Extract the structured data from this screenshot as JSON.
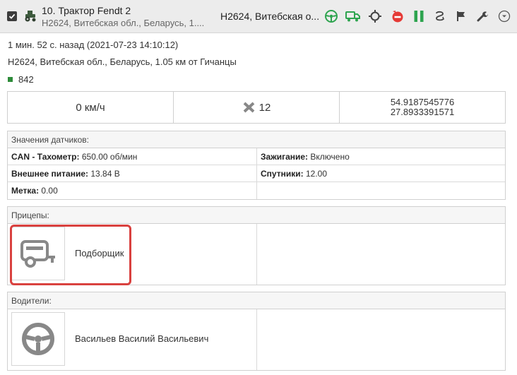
{
  "header": {
    "unit_name": "10. Трактор Fendt 2",
    "unit_address": "Н2624, Витебская обл., Беларусь, 1....",
    "address_short": "Н2624, Витебская о...",
    "icons": [
      "steering-wheel-icon",
      "truck-trailer-icon",
      "locate-icon",
      "no-entry-icon",
      "pause-icon",
      "route-icon",
      "flag-icon",
      "wrench-icon",
      "dropdown-icon"
    ],
    "colors": {
      "green": "#2ea44f",
      "red": "#e53935",
      "dark": "#3c3c3c"
    }
  },
  "info": {
    "last_message": "1 мин. 52 с. назад (2021-07-23 14:10:12)",
    "full_address": "Н2624, Витебская обл., Беларусь, 1.05 км от Гичанцы",
    "value": "842"
  },
  "stats": {
    "speed": "0 км/ч",
    "satellites": "12",
    "lat": "54.9187545776",
    "lon": "27.8933391571"
  },
  "sensors": {
    "title": "Значения датчиков:",
    "rows": [
      [
        {
          "k": "CAN - Тахометр:",
          "v": "650.00 об/мин"
        },
        {
          "k": "Зажигание:",
          "v": "Включено"
        }
      ],
      [
        {
          "k": "Внешнее питание:",
          "v": "13.84 В"
        },
        {
          "k": "Спутники:",
          "v": "12.00"
        }
      ],
      [
        {
          "k": "Метка:",
          "v": "0.00"
        },
        {
          "k": "",
          "v": ""
        }
      ]
    ]
  },
  "trailers": {
    "title": "Прицепы:",
    "item": "Подборщик"
  },
  "drivers": {
    "title": "Водители:",
    "item": "Васильев Василий Васильевич"
  }
}
